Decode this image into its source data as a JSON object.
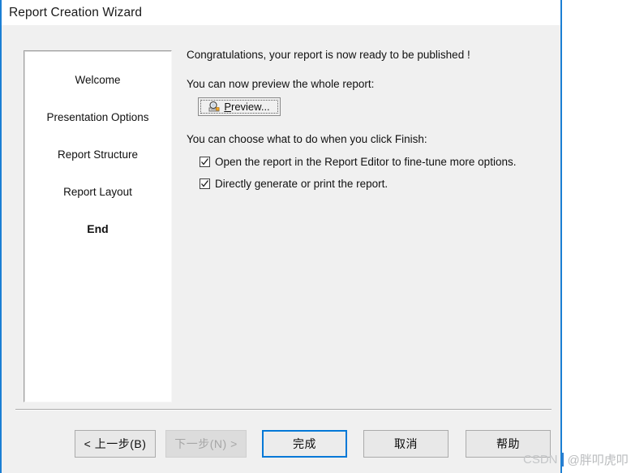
{
  "window": {
    "title": "Report Creation Wizard",
    "accent_color": "#1b7fd4",
    "body_color": "#f0f0f0"
  },
  "steps_panel": {
    "items": [
      {
        "label": "Welcome",
        "current": false
      },
      {
        "label": "Presentation Options",
        "current": false
      },
      {
        "label": "Report Structure",
        "current": false
      },
      {
        "label": "Report Layout",
        "current": false
      },
      {
        "label": "End",
        "current": true
      }
    ]
  },
  "content": {
    "congratulations": "Congratulations, your report is now ready to be published !",
    "preview_prompt": "You can now preview the whole report:",
    "preview_button": {
      "mnemonic": "P",
      "rest": "review...",
      "icon": "print-preview-icon"
    },
    "finish_prompt": "You can choose what to do when you click Finish:",
    "checkboxes": [
      {
        "checked": true,
        "pre": "Open the report in the Report Editor to fine-tune more options.",
        "mnemonic": "",
        "post": ""
      },
      {
        "checked": true,
        "pre": "Directly ",
        "mnemonic": "g",
        "post": "enerate or print the report."
      }
    ]
  },
  "footer": {
    "buttons": [
      {
        "id": "back",
        "label": "< 上一步(B)",
        "state": "enabled"
      },
      {
        "id": "next",
        "label": "下一步(N) >",
        "state": "disabled"
      },
      {
        "id": "finish",
        "label": "完成",
        "state": "default"
      },
      {
        "id": "cancel",
        "label": "取消",
        "state": "enabled"
      },
      {
        "id": "help",
        "label": "帮助",
        "state": "enabled"
      }
    ]
  },
  "watermark": {
    "brand": "CSDN",
    "handle": "@胖叩虎叩"
  }
}
